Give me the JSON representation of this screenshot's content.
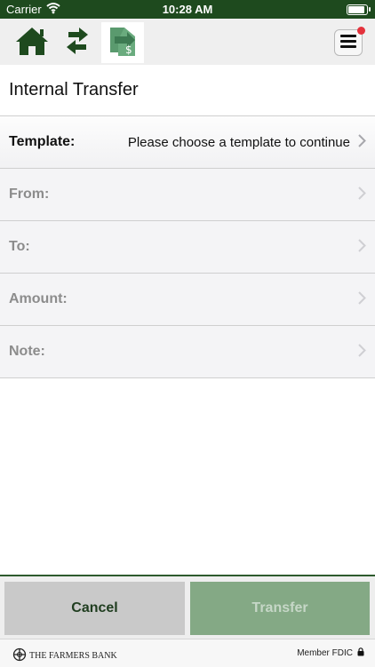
{
  "status_bar": {
    "carrier": "Carrier",
    "time": "10:28 AM"
  },
  "nav": {
    "tabs": [
      {
        "icon": "home-icon",
        "active": false
      },
      {
        "icon": "transfer-arrows-icon",
        "active": false
      },
      {
        "icon": "money-transfer-icon",
        "active": true
      }
    ],
    "menu_icon": "hamburger-menu-icon",
    "notification_dot": true
  },
  "page": {
    "title": "Internal Transfer"
  },
  "form": {
    "template": {
      "label": "Template:",
      "value": "Please choose a template to continue"
    },
    "from": {
      "label": "From:",
      "value": ""
    },
    "to": {
      "label": "To:",
      "value": ""
    },
    "amount": {
      "label": "Amount:",
      "value": ""
    },
    "note": {
      "label": "Note:",
      "value": ""
    }
  },
  "actions": {
    "cancel_label": "Cancel",
    "transfer_label": "Transfer"
  },
  "footer": {
    "bank_name": "THE FARMERS BANK",
    "fdic": "Member FDIC"
  },
  "colors": {
    "brand_green": "#1e4a1e",
    "accent_green": "#84a985",
    "notification_red": "#e4323c"
  }
}
